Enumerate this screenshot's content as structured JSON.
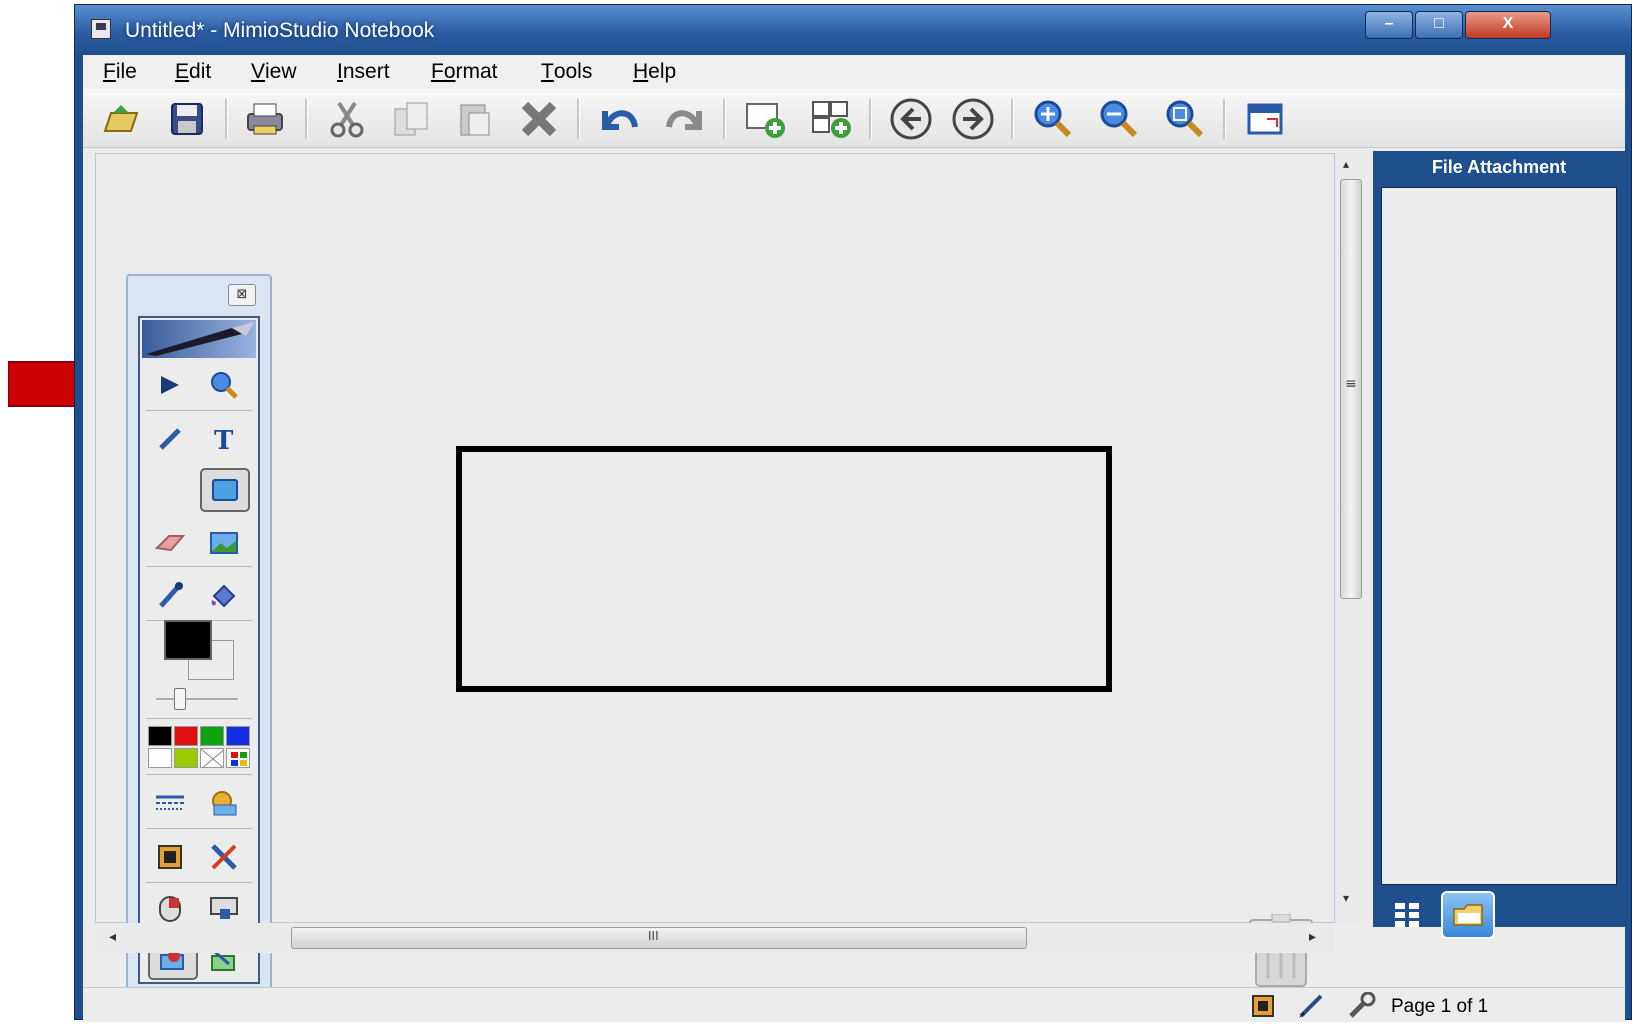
{
  "window": {
    "title": "Untitled* - MimioStudio Notebook",
    "controls": {
      "minimize": "–",
      "maximize": "□",
      "close": "X"
    }
  },
  "menubar": {
    "items": [
      {
        "accel": "F",
        "rest": "ile"
      },
      {
        "accel": "E",
        "rest": "dit"
      },
      {
        "accel": "V",
        "rest": "iew"
      },
      {
        "accel": "I",
        "rest": "nsert"
      },
      {
        "accel": "Fo",
        "rest": "rmat"
      },
      {
        "accel": "T",
        "rest": "ools"
      },
      {
        "accel": "H",
        "rest": "elp"
      }
    ]
  },
  "toolbar": {
    "buttons": [
      "open-icon",
      "save-icon",
      "print-icon",
      "cut-icon",
      "copy-icon",
      "paste-icon",
      "delete-icon",
      "undo-icon",
      "redo-icon",
      "new-page-icon",
      "duplicate-page-icon",
      "previous-page-icon",
      "next-page-icon",
      "zoom-in-icon",
      "zoom-out-icon",
      "zoom-fit-icon",
      "window-view-icon"
    ]
  },
  "toolbox": {
    "close_label": "⊠",
    "selected_tool": "rectangle-tool",
    "colors": [
      "#000000",
      "#e01010",
      "#10a010",
      "#1030e0",
      "#ffffff",
      "#99cc00"
    ],
    "current_color": "#000000"
  },
  "canvas": {
    "shape_type": "rectangle",
    "scroll_grip": "≡",
    "hscroll_grip": "III",
    "left_arrow": "◂",
    "right_arrow": "▸",
    "up_arrow": "▴",
    "down_arrow": "▾"
  },
  "right_panel": {
    "title": "File Attachment"
  },
  "statusbar": {
    "page_text": "Page 1 of 1"
  },
  "annotation": {
    "arrow_color": "#cc0000"
  }
}
